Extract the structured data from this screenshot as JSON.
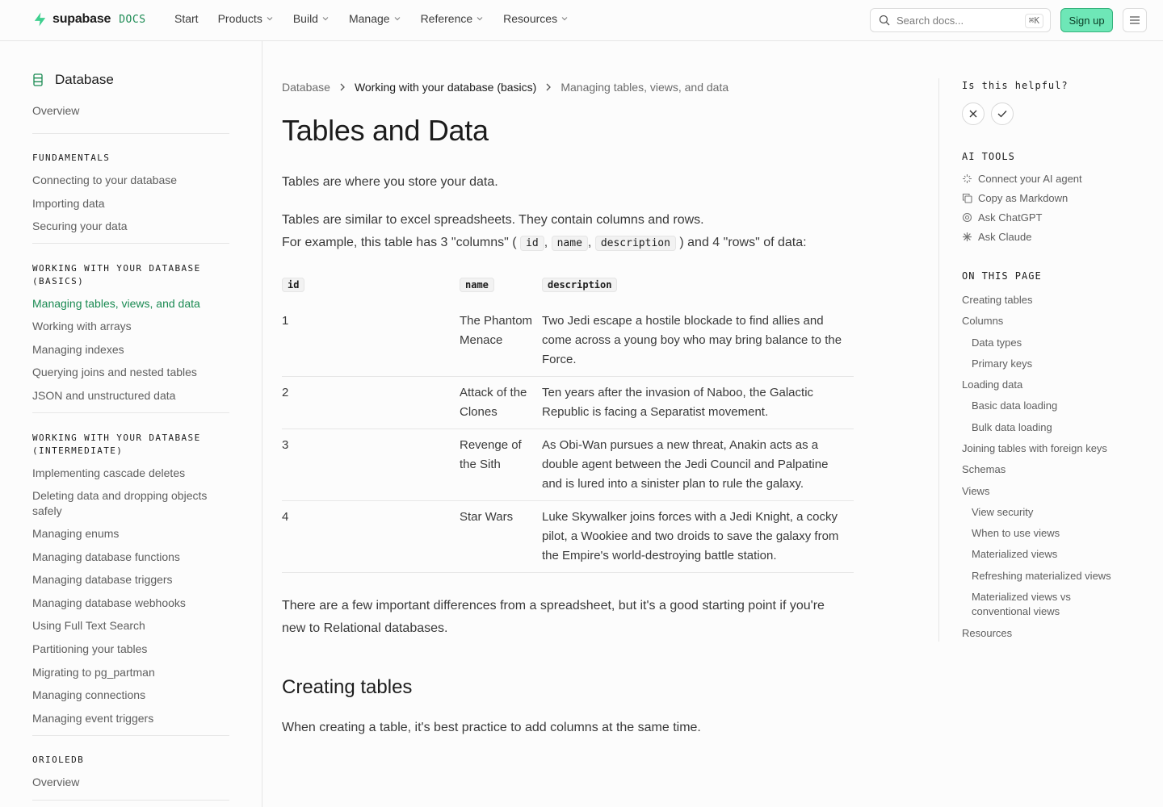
{
  "nav": {
    "brand": "supabase",
    "brand_suffix": "DOCS",
    "links": [
      {
        "label": "Start",
        "dropdown": false
      },
      {
        "label": "Products",
        "dropdown": true
      },
      {
        "label": "Build",
        "dropdown": true
      },
      {
        "label": "Manage",
        "dropdown": true
      },
      {
        "label": "Reference",
        "dropdown": true
      },
      {
        "label": "Resources",
        "dropdown": true
      }
    ],
    "search_placeholder": "Search docs...",
    "search_shortcut": "⌘K",
    "signup": "Sign up"
  },
  "sidebar": {
    "title": "Database",
    "overview": "Overview",
    "sec_fundamentals": "FUNDAMENTALS",
    "fundamentals": [
      "Connecting to your database",
      "Importing data",
      "Securing your data"
    ],
    "sec_basics": "WORKING WITH YOUR DATABASE (BASICS)",
    "basics": [
      "Managing tables, views, and data",
      "Working with arrays",
      "Managing indexes",
      "Querying joins and nested tables",
      "JSON and unstructured data"
    ],
    "sec_intermediate": "WORKING WITH YOUR DATABASE (INTERMEDIATE)",
    "intermediate": [
      "Implementing cascade deletes",
      "Deleting data and dropping objects safely",
      "Managing enums",
      "Managing database functions",
      "Managing database triggers",
      "Managing database webhooks",
      "Using Full Text Search",
      "Partitioning your tables",
      "Migrating to pg_partman",
      "Managing connections",
      "Managing event triggers"
    ],
    "sec_orioledb": "ORIOLEDB",
    "orioledb": [
      "Overview"
    ]
  },
  "breadcrumb": {
    "first": "Database",
    "second": "Working with your database (basics)",
    "third": "Managing tables, views, and data"
  },
  "page": {
    "title": "Tables and Data",
    "intro": "Tables are where you store your data.",
    "similar": "Tables are similar to excel spreadsheets. They contain columns and rows.",
    "example_pre": "For example, this table has 3 \"columns\" (",
    "example_c1": "id",
    "example_c2": "name",
    "example_c3": "description",
    "example_post": ") and 4 \"rows\" of data:",
    "sep": ",",
    "after_table": "There are a few important differences from a spreadsheet, but it's a good starting point if you're new to Relational databases.",
    "h2_creating": "Creating tables",
    "creating_text": "When creating a table, it's best practice to add columns at the same time."
  },
  "table": {
    "headers": [
      "id",
      "name",
      "description"
    ],
    "rows": [
      {
        "id": "1",
        "name": "The Phantom Menace",
        "description": "Two Jedi escape a hostile blockade to find allies and come across a young boy who may bring balance to the Force."
      },
      {
        "id": "2",
        "name": "Attack of the Clones",
        "description": "Ten years after the invasion of Naboo, the Galactic Republic is facing a Separatist movement."
      },
      {
        "id": "3",
        "name": "Revenge of the Sith",
        "description": "As Obi-Wan pursues a new threat, Anakin acts as a double agent between the Jedi Council and Palpatine and is lured into a sinister plan to rule the galaxy."
      },
      {
        "id": "4",
        "name": "Star Wars",
        "description": "Luke Skywalker joins forces with a Jedi Knight, a cocky pilot, a Wookiee and two droids to save the galaxy from the Empire's world-destroying battle station."
      }
    ]
  },
  "rightrail": {
    "helpful": "Is this helpful?",
    "ai_title": "AI TOOLS",
    "ai": [
      "Connect your AI agent",
      "Copy as Markdown",
      "Ask ChatGPT",
      "Ask Claude"
    ],
    "toc_title": "ON THIS PAGE",
    "toc": [
      {
        "label": "Creating tables",
        "level": 1
      },
      {
        "label": "Columns",
        "level": 1
      },
      {
        "label": "Data types",
        "level": 2
      },
      {
        "label": "Primary keys",
        "level": 2
      },
      {
        "label": "Loading data",
        "level": 1
      },
      {
        "label": "Basic data loading",
        "level": 2
      },
      {
        "label": "Bulk data loading",
        "level": 2
      },
      {
        "label": "Joining tables with foreign keys",
        "level": 1
      },
      {
        "label": "Schemas",
        "level": 1
      },
      {
        "label": "Views",
        "level": 1
      },
      {
        "label": "View security",
        "level": 2
      },
      {
        "label": "When to use views",
        "level": 2
      },
      {
        "label": "Materialized views",
        "level": 2
      },
      {
        "label": "Refreshing materialized views",
        "level": 2
      },
      {
        "label": "Materialized views vs conventional views",
        "level": 2
      },
      {
        "label": "Resources",
        "level": 1
      }
    ]
  },
  "colors": {
    "accent": "#1a8a52",
    "signup_bg": "#6ee7b7",
    "border": "#e6e6e6"
  }
}
